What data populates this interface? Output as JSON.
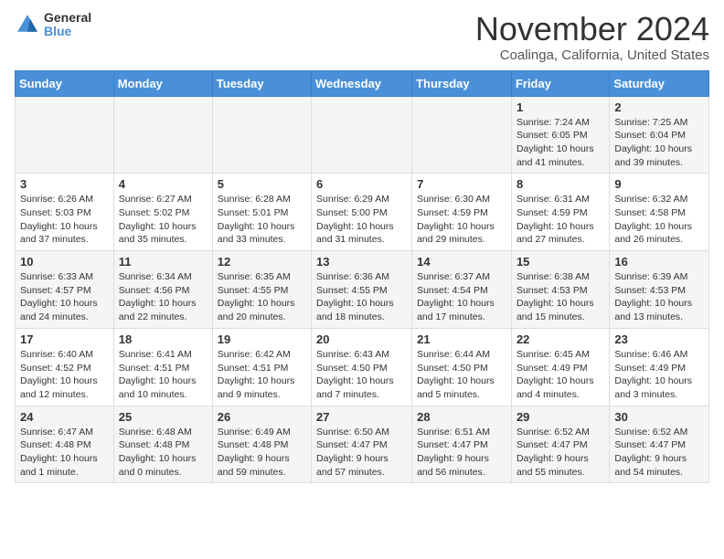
{
  "logo": {
    "general": "General",
    "blue": "Blue"
  },
  "title": "November 2024",
  "location": "Coalinga, California, United States",
  "days_of_week": [
    "Sunday",
    "Monday",
    "Tuesday",
    "Wednesday",
    "Thursday",
    "Friday",
    "Saturday"
  ],
  "weeks": [
    [
      {
        "day": "",
        "info": ""
      },
      {
        "day": "",
        "info": ""
      },
      {
        "day": "",
        "info": ""
      },
      {
        "day": "",
        "info": ""
      },
      {
        "day": "",
        "info": ""
      },
      {
        "day": "1",
        "info": "Sunrise: 7:24 AM\nSunset: 6:05 PM\nDaylight: 10 hours and 41 minutes."
      },
      {
        "day": "2",
        "info": "Sunrise: 7:25 AM\nSunset: 6:04 PM\nDaylight: 10 hours and 39 minutes."
      }
    ],
    [
      {
        "day": "3",
        "info": "Sunrise: 6:26 AM\nSunset: 5:03 PM\nDaylight: 10 hours and 37 minutes."
      },
      {
        "day": "4",
        "info": "Sunrise: 6:27 AM\nSunset: 5:02 PM\nDaylight: 10 hours and 35 minutes."
      },
      {
        "day": "5",
        "info": "Sunrise: 6:28 AM\nSunset: 5:01 PM\nDaylight: 10 hours and 33 minutes."
      },
      {
        "day": "6",
        "info": "Sunrise: 6:29 AM\nSunset: 5:00 PM\nDaylight: 10 hours and 31 minutes."
      },
      {
        "day": "7",
        "info": "Sunrise: 6:30 AM\nSunset: 4:59 PM\nDaylight: 10 hours and 29 minutes."
      },
      {
        "day": "8",
        "info": "Sunrise: 6:31 AM\nSunset: 4:59 PM\nDaylight: 10 hours and 27 minutes."
      },
      {
        "day": "9",
        "info": "Sunrise: 6:32 AM\nSunset: 4:58 PM\nDaylight: 10 hours and 26 minutes."
      }
    ],
    [
      {
        "day": "10",
        "info": "Sunrise: 6:33 AM\nSunset: 4:57 PM\nDaylight: 10 hours and 24 minutes."
      },
      {
        "day": "11",
        "info": "Sunrise: 6:34 AM\nSunset: 4:56 PM\nDaylight: 10 hours and 22 minutes."
      },
      {
        "day": "12",
        "info": "Sunrise: 6:35 AM\nSunset: 4:55 PM\nDaylight: 10 hours and 20 minutes."
      },
      {
        "day": "13",
        "info": "Sunrise: 6:36 AM\nSunset: 4:55 PM\nDaylight: 10 hours and 18 minutes."
      },
      {
        "day": "14",
        "info": "Sunrise: 6:37 AM\nSunset: 4:54 PM\nDaylight: 10 hours and 17 minutes."
      },
      {
        "day": "15",
        "info": "Sunrise: 6:38 AM\nSunset: 4:53 PM\nDaylight: 10 hours and 15 minutes."
      },
      {
        "day": "16",
        "info": "Sunrise: 6:39 AM\nSunset: 4:53 PM\nDaylight: 10 hours and 13 minutes."
      }
    ],
    [
      {
        "day": "17",
        "info": "Sunrise: 6:40 AM\nSunset: 4:52 PM\nDaylight: 10 hours and 12 minutes."
      },
      {
        "day": "18",
        "info": "Sunrise: 6:41 AM\nSunset: 4:51 PM\nDaylight: 10 hours and 10 minutes."
      },
      {
        "day": "19",
        "info": "Sunrise: 6:42 AM\nSunset: 4:51 PM\nDaylight: 10 hours and 9 minutes."
      },
      {
        "day": "20",
        "info": "Sunrise: 6:43 AM\nSunset: 4:50 PM\nDaylight: 10 hours and 7 minutes."
      },
      {
        "day": "21",
        "info": "Sunrise: 6:44 AM\nSunset: 4:50 PM\nDaylight: 10 hours and 5 minutes."
      },
      {
        "day": "22",
        "info": "Sunrise: 6:45 AM\nSunset: 4:49 PM\nDaylight: 10 hours and 4 minutes."
      },
      {
        "day": "23",
        "info": "Sunrise: 6:46 AM\nSunset: 4:49 PM\nDaylight: 10 hours and 3 minutes."
      }
    ],
    [
      {
        "day": "24",
        "info": "Sunrise: 6:47 AM\nSunset: 4:48 PM\nDaylight: 10 hours and 1 minute."
      },
      {
        "day": "25",
        "info": "Sunrise: 6:48 AM\nSunset: 4:48 PM\nDaylight: 10 hours and 0 minutes."
      },
      {
        "day": "26",
        "info": "Sunrise: 6:49 AM\nSunset: 4:48 PM\nDaylight: 9 hours and 59 minutes."
      },
      {
        "day": "27",
        "info": "Sunrise: 6:50 AM\nSunset: 4:47 PM\nDaylight: 9 hours and 57 minutes."
      },
      {
        "day": "28",
        "info": "Sunrise: 6:51 AM\nSunset: 4:47 PM\nDaylight: 9 hours and 56 minutes."
      },
      {
        "day": "29",
        "info": "Sunrise: 6:52 AM\nSunset: 4:47 PM\nDaylight: 9 hours and 55 minutes."
      },
      {
        "day": "30",
        "info": "Sunrise: 6:52 AM\nSunset: 4:47 PM\nDaylight: 9 hours and 54 minutes."
      }
    ]
  ]
}
